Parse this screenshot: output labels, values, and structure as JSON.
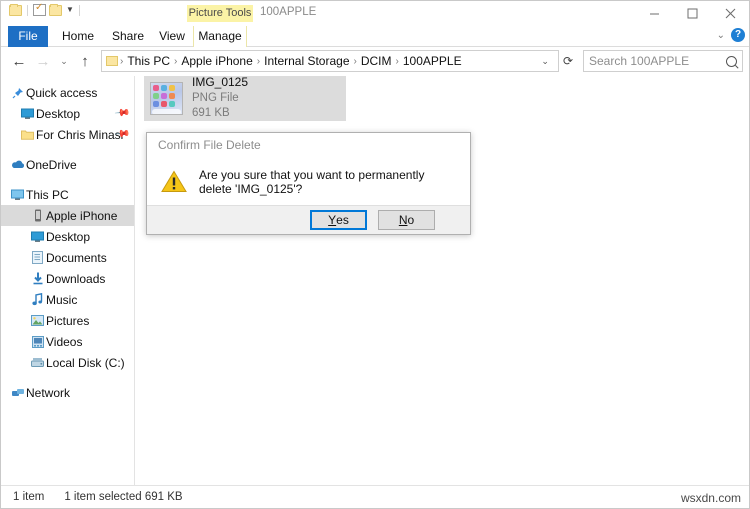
{
  "window": {
    "title": "100APPLE",
    "contextual_tab": "Picture Tools",
    "controls": {
      "minimize": "minimize-icon",
      "maximize": "maximize-icon",
      "close": "close-icon"
    },
    "ribbon_collapse": "chevron-down-icon",
    "help": "?"
  },
  "quick_access": {
    "folder": "folder-icon",
    "properties": "properties-checkbox-icon",
    "new_folder": "new-folder-icon",
    "customize": "chevron-down-icon"
  },
  "ribbon": {
    "tabs": [
      {
        "label": "File",
        "selected": true
      },
      {
        "label": "Home",
        "selected": false
      },
      {
        "label": "Share",
        "selected": false
      },
      {
        "label": "View",
        "selected": false
      },
      {
        "label": "Manage",
        "selected": false
      }
    ]
  },
  "address": {
    "back": "back-arrow-icon",
    "forward": "forward-arrow-icon",
    "recent": "chevron-down-icon",
    "up": "up-arrow-icon",
    "folder_icon": "folder-icon",
    "crumbs": [
      "This PC",
      "Apple iPhone",
      "Internal Storage",
      "DCIM",
      "100APPLE"
    ],
    "separator": "›",
    "dropdown": "chevron-down-icon",
    "refresh": "refresh-icon"
  },
  "search": {
    "placeholder": "Search 100APPLE",
    "value": "Search 100APPLE",
    "icon": "search-icon"
  },
  "sidebar": {
    "items": [
      {
        "label": "Quick access",
        "icon": "pin-icon",
        "indent": 0,
        "selected": false,
        "pinned": false
      },
      {
        "label": "Desktop",
        "icon": "desktop-icon",
        "indent": 1,
        "selected": false,
        "pinned": true
      },
      {
        "label": "For Chris Minasi",
        "icon": "folder-icon",
        "indent": 1,
        "selected": false,
        "pinned": true
      },
      {
        "label": "OneDrive",
        "icon": "cloud-icon",
        "indent": 0,
        "selected": false,
        "pinned": false
      },
      {
        "label": "This PC",
        "icon": "pc-icon",
        "indent": 0,
        "selected": false,
        "pinned": false
      },
      {
        "label": "Apple iPhone",
        "icon": "phone-icon",
        "indent": 1,
        "selected": true,
        "pinned": false
      },
      {
        "label": "Desktop",
        "icon": "desktop-icon",
        "indent": 1,
        "selected": false,
        "pinned": false
      },
      {
        "label": "Documents",
        "icon": "documents-icon",
        "indent": 1,
        "selected": false,
        "pinned": false
      },
      {
        "label": "Downloads",
        "icon": "downloads-icon",
        "indent": 1,
        "selected": false,
        "pinned": false
      },
      {
        "label": "Music",
        "icon": "music-icon",
        "indent": 1,
        "selected": false,
        "pinned": false
      },
      {
        "label": "Pictures",
        "icon": "pictures-icon",
        "indent": 1,
        "selected": false,
        "pinned": false
      },
      {
        "label": "Videos",
        "icon": "videos-icon",
        "indent": 1,
        "selected": false,
        "pinned": false
      },
      {
        "label": "Local Disk (C:)",
        "icon": "disk-icon",
        "indent": 1,
        "selected": false,
        "pinned": false
      },
      {
        "label": "Network",
        "icon": "network-icon",
        "indent": 0,
        "selected": false,
        "pinned": false
      }
    ]
  },
  "files": [
    {
      "name": "IMG_0125",
      "type": "PNG File",
      "size": "691 KB",
      "selected": true,
      "thumbnail": "iphone-screenshot-thumbnail"
    }
  ],
  "dialog": {
    "title": "Confirm File Delete",
    "icon": "warning-icon",
    "message": "Are you sure that you want to permanently delete 'IMG_0125'?",
    "buttons": [
      {
        "label": "Yes",
        "accel": "Y",
        "focused": true
      },
      {
        "label": "No",
        "accel": "N",
        "focused": false
      }
    ]
  },
  "status": {
    "item_count": "1 item",
    "selection": "1 item selected  691 KB"
  },
  "watermark": "wsxdn.com",
  "colors": {
    "accent": "#1e6fc4",
    "contextual_tab": "#fbf3a6",
    "selection": "#dcdcdc",
    "focus_border": "#0078d7",
    "warning": "#f5c518"
  }
}
